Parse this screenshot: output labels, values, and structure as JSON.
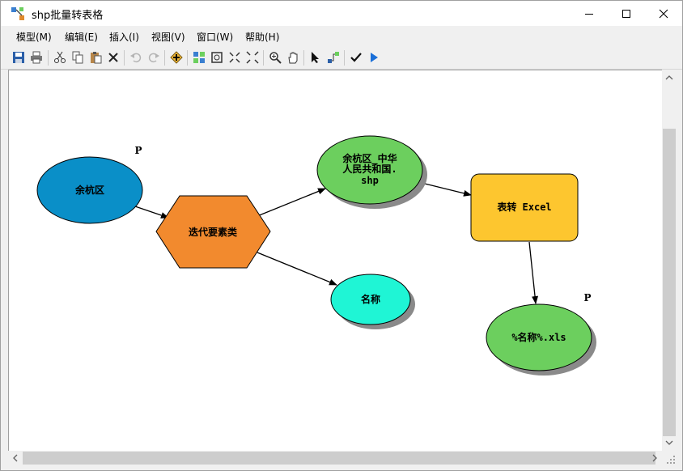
{
  "window": {
    "title": "shp批量转表格"
  },
  "menu": {
    "items": [
      "模型(M)",
      "编辑(E)",
      "插入(I)",
      "视图(V)",
      "窗口(W)",
      "帮助(H)"
    ]
  },
  "toolbar": {
    "icons": [
      "save-icon",
      "print-icon",
      "cut-icon",
      "copy-icon",
      "paste-icon",
      "delete-icon",
      "undo-icon",
      "redo-icon",
      "add-data-icon",
      "auto-layout-icon",
      "full-extent-icon",
      "zoom-in-fixed-icon",
      "zoom-out-fixed-icon",
      "zoom-icon",
      "pan-icon",
      "select-icon",
      "connect-icon",
      "validate-icon",
      "run-icon"
    ]
  },
  "diagram": {
    "nodes": {
      "input": "余杭区",
      "iterator": "迭代要素类",
      "output_shp_line1": "余杭区_中华",
      "output_shp_line2": "人民共和国.",
      "output_shp_line3": "shp",
      "name_var": "名称",
      "tool": "表转 Excel",
      "output_xls": "%名称%.xls"
    },
    "param_marker": "P",
    "colors": {
      "input": "#0a8fc8",
      "iterator": "#f28a2e",
      "output": "#6ccf5e",
      "name_var": "#1ff5d5",
      "tool": "#fdc62f"
    }
  }
}
